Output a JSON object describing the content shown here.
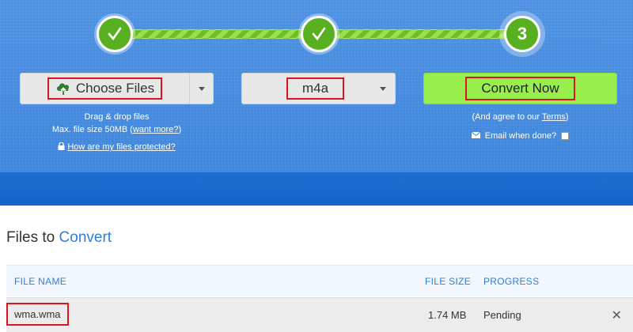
{
  "steps": [
    {
      "state": "done",
      "icon": "check-icon"
    },
    {
      "state": "done",
      "icon": "check-icon"
    },
    {
      "state": "current",
      "number": "3"
    }
  ],
  "choose_files": {
    "label": "Choose Files",
    "icon": "cloud-upload-icon"
  },
  "format_select": {
    "value": "m4a"
  },
  "convert_button": {
    "label": "Convert Now"
  },
  "upload_info": {
    "drag_drop": "Drag & drop files",
    "max_size": "Max. file size 50MB",
    "want_more": "want more?",
    "protected_link": "How are my files protected?"
  },
  "terms": {
    "prefix": "(And agree to our",
    "link": "Terms",
    "suffix": ")"
  },
  "email": {
    "label": "Email when done?"
  },
  "files_section": {
    "title_plain": "Files to",
    "title_accent": "Convert"
  },
  "table": {
    "headers": {
      "name": "FILE NAME",
      "size": "FILE SIZE",
      "progress": "PROGRESS"
    },
    "rows": [
      {
        "name": "wma.wma",
        "size": "1.74 MB",
        "progress": "Pending"
      }
    ]
  },
  "colors": {
    "accent": "#2f7fd6",
    "convert_bg": "#97ee4c",
    "step_green": "#58b020",
    "highlight": "#e0141e"
  }
}
